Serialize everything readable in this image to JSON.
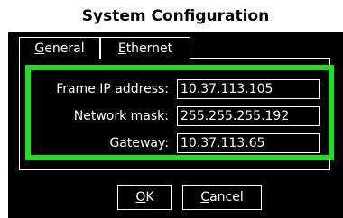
{
  "window": {
    "title": "System Configuration"
  },
  "tabs": [
    {
      "label_hotkey": "G",
      "label_rest": "eneral"
    },
    {
      "label_hotkey": "E",
      "label_rest": "thernet"
    }
  ],
  "fields": [
    {
      "label": "Frame IP address:",
      "value": "10.37.113.105"
    },
    {
      "label": "Network mask:",
      "value": "255.255.255.192"
    },
    {
      "label": "Gateway:",
      "value": "10.37.113.65"
    }
  ],
  "buttons": {
    "ok": {
      "hotkey": "O",
      "rest": "K"
    },
    "cancel": {
      "hotkey": "C",
      "rest": "ancel"
    }
  },
  "colors": {
    "highlight_border": "#22dd22"
  }
}
